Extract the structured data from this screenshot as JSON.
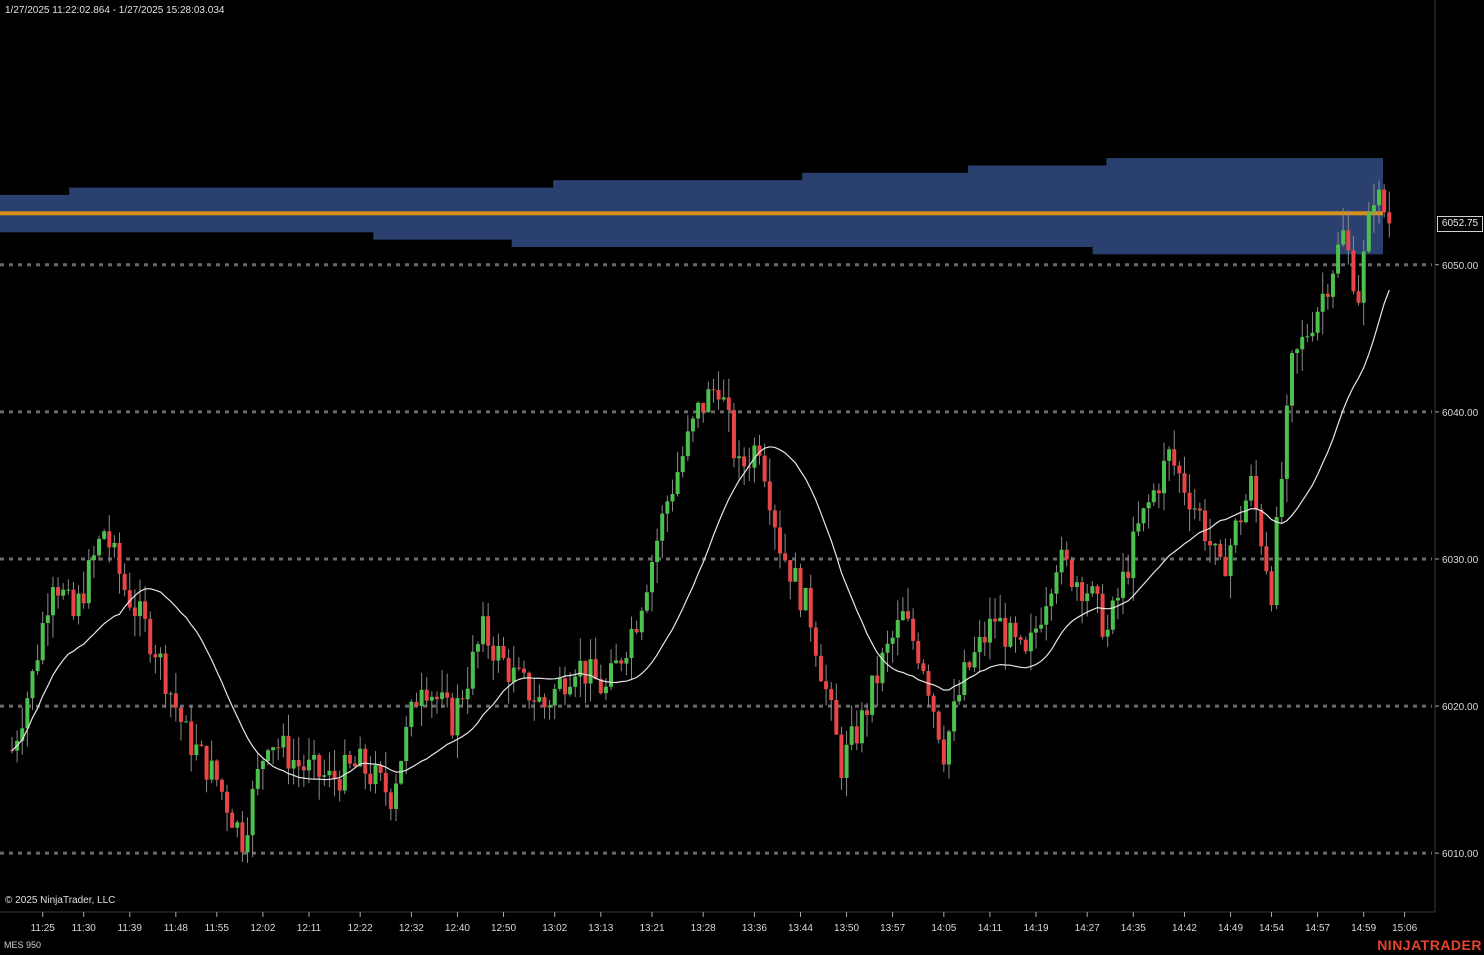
{
  "header": {
    "range": "1/27/2025 11:22:02.864 - 1/27/2025 15:28:03.034"
  },
  "footer": {
    "copyright": "© 2025 NinjaTrader, LLC",
    "instrument": "MES 950",
    "brand": "NINJATRADER"
  },
  "colors": {
    "background": "#000000",
    "bull": "#4cc04c",
    "bear": "#e84646",
    "ma": "#e6e6e6",
    "profile": "#2a4170",
    "poc": "#d8901c",
    "grid": "#6a6a6a",
    "brand": "#e8432e"
  },
  "chart_data": {
    "type": "candlestick",
    "ylim": [
      6006.0,
      6068.0
    ],
    "y_ticks": [
      6010.0,
      6020.0,
      6030.0,
      6040.0,
      6050.0
    ],
    "y_tick_labels": [
      "6010.00",
      "6020.00",
      "6030.00",
      "6040.00",
      "6050.00"
    ],
    "last_price": 6052.75,
    "last_price_label": "6052.75",
    "x_labels": [
      "11:25",
      "11:30",
      "11:39",
      "11:48",
      "11:55",
      "12:02",
      "12:11",
      "12:22",
      "12:32",
      "12:40",
      "12:50",
      "13:02",
      "13:13",
      "13:21",
      "13:28",
      "13:36",
      "13:44",
      "13:50",
      "13:57",
      "14:05",
      "14:11",
      "14:19",
      "14:27",
      "14:35",
      "14:42",
      "14:49",
      "14:54",
      "14:57",
      "14:59",
      "15:06"
    ],
    "x_label_slots": [
      6,
      14,
      23,
      32,
      40,
      49,
      58,
      68,
      78,
      87,
      96,
      106,
      115,
      125,
      135,
      145,
      154,
      163,
      172,
      182,
      191,
      200,
      210,
      219,
      229,
      238,
      246,
      255,
      264,
      272
    ],
    "price_path": [
      [
        0,
        6017
      ],
      [
        4,
        6022
      ],
      [
        8,
        6029
      ],
      [
        12,
        6026
      ],
      [
        18,
        6032
      ],
      [
        22,
        6028
      ],
      [
        28,
        6024
      ],
      [
        34,
        6018
      ],
      [
        40,
        6015
      ],
      [
        45,
        6011
      ],
      [
        50,
        6018
      ],
      [
        56,
        6016
      ],
      [
        62,
        6015
      ],
      [
        68,
        6016
      ],
      [
        74,
        6014
      ],
      [
        80,
        6022
      ],
      [
        86,
        6019
      ],
      [
        92,
        6025
      ],
      [
        98,
        6022
      ],
      [
        104,
        6020
      ],
      [
        110,
        6023
      ],
      [
        116,
        6021
      ],
      [
        122,
        6026
      ],
      [
        128,
        6034
      ],
      [
        134,
        6040
      ],
      [
        138,
        6042
      ],
      [
        142,
        6036
      ],
      [
        146,
        6038
      ],
      [
        150,
        6031
      ],
      [
        156,
        6026
      ],
      [
        162,
        6016
      ],
      [
        166,
        6019
      ],
      [
        170,
        6023
      ],
      [
        174,
        6026
      ],
      [
        178,
        6023
      ],
      [
        182,
        6017
      ],
      [
        186,
        6022
      ],
      [
        192,
        6026
      ],
      [
        198,
        6023
      ],
      [
        204,
        6030
      ],
      [
        210,
        6028
      ],
      [
        214,
        6025
      ],
      [
        220,
        6032
      ],
      [
        226,
        6037
      ],
      [
        232,
        6033
      ],
      [
        236,
        6029
      ],
      [
        242,
        6035
      ],
      [
        246,
        6028
      ],
      [
        250,
        6043
      ],
      [
        256,
        6048
      ],
      [
        260,
        6052
      ],
      [
        263,
        6048
      ],
      [
        266,
        6055
      ],
      [
        269,
        6053
      ]
    ],
    "ma_period": 22,
    "volume_profile": {
      "poc": 6053.5,
      "levels": [
        {
          "price": 6057.0,
          "volume": 0.2
        },
        {
          "price": 6056.5,
          "volume": 0.3
        },
        {
          "price": 6056.0,
          "volume": 0.42
        },
        {
          "price": 6055.5,
          "volume": 0.6
        },
        {
          "price": 6055.0,
          "volume": 0.95
        },
        {
          "price": 6054.5,
          "volume": 1.0
        },
        {
          "price": 6054.0,
          "volume": 1.0
        },
        {
          "price": 6053.5,
          "volume": 1.0
        },
        {
          "price": 6053.0,
          "volume": 1.0
        },
        {
          "price": 6052.5,
          "volume": 1.0
        },
        {
          "price": 6052.0,
          "volume": 0.73
        },
        {
          "price": 6051.5,
          "volume": 0.63
        },
        {
          "price": 6051.0,
          "volume": 0.21
        }
      ]
    }
  }
}
